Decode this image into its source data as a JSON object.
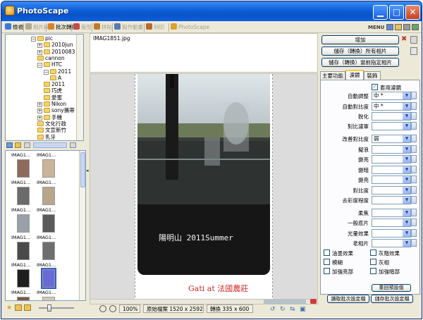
{
  "window": {
    "title": "PhotoScape"
  },
  "toolbar": {
    "items": [
      {
        "label": "檢視",
        "dim": false,
        "color": "#3a7bd5"
      },
      {
        "label": "相片編輯",
        "dim": true,
        "color": "#b0a890"
      },
      {
        "label": "批次轉換",
        "dim": false,
        "color": "#d9822b"
      },
      {
        "label": "版型",
        "dim": true,
        "color": "#c24a4a"
      },
      {
        "label": "拼貼",
        "dim": true,
        "color": "#c27a2a"
      },
      {
        "label": "製作動畫",
        "dim": true,
        "color": "#5a7ab0"
      },
      {
        "label": "列印",
        "dim": true,
        "color": "#b86a30"
      },
      {
        "label": "PhotoScape",
        "dim": true,
        "color": "#e0a030"
      }
    ],
    "menu_label": "MENU"
  },
  "tree": [
    {
      "indent": 0,
      "pm": "−",
      "label": "pic"
    },
    {
      "indent": 1,
      "pm": "+",
      "label": "2010jun"
    },
    {
      "indent": 1,
      "pm": "+",
      "label": "2010083"
    },
    {
      "indent": 1,
      "pm": "",
      "label": "cannon"
    },
    {
      "indent": 1,
      "pm": "−",
      "label": "HTC"
    },
    {
      "indent": 2,
      "pm": "−",
      "label": "2011"
    },
    {
      "indent": 3,
      "pm": "",
      "label": "A"
    },
    {
      "indent": 2,
      "pm": "",
      "label": "2011"
    },
    {
      "indent": 2,
      "pm": "",
      "label": "巧虎"
    },
    {
      "indent": 2,
      "pm": "",
      "label": "愛蜜"
    },
    {
      "indent": 1,
      "pm": "+",
      "label": "Nikon"
    },
    {
      "indent": 1,
      "pm": "+",
      "label": "sony攜帶"
    },
    {
      "indent": 1,
      "pm": "+",
      "label": "手機"
    },
    {
      "indent": 1,
      "pm": "",
      "label": "文化行政"
    },
    {
      "indent": 1,
      "pm": "",
      "label": "文宣新竹"
    },
    {
      "indent": 1,
      "pm": "",
      "label": "乳牙"
    }
  ],
  "thumbnails": [
    {
      "name": "IMAG1...",
      "selected": false
    },
    {
      "name": "IMAG1...",
      "selected": false
    },
    {
      "name": "IMAG1...",
      "selected": false
    },
    {
      "name": "IMAG1...",
      "selected": false
    },
    {
      "name": "IMAG1...",
      "selected": false
    },
    {
      "name": "IMAG1...",
      "selected": false
    },
    {
      "name": "IMAG1...",
      "selected": false
    },
    {
      "name": "IMAG1...",
      "selected": false
    },
    {
      "name": "IMAG1...",
      "selected": false
    },
    {
      "name": "IMAG1...",
      "selected": true
    },
    {
      "name": "IMAG1...",
      "selected": false
    },
    {
      "name": "IMAG1...",
      "selected": false
    }
  ],
  "image": {
    "filename": "IMAG1851.jpg",
    "caption": "陽明山 2011Summer",
    "footer": "Gati at 法國農莊"
  },
  "status": {
    "zoom": "100%",
    "original": "原始檔案 1520 x 2592",
    "converted": "轉換 335 x 600"
  },
  "right": {
    "add_button": "增加",
    "save_all_button": "儲存（轉換）所有相片",
    "save_selected_button": "儲存（轉換）當前指定相片",
    "tabs": [
      "主要功能",
      "濾鏡",
      "裝飾"
    ],
    "active_tab": 1,
    "apply_filter_label": "套用濾鏡",
    "props": [
      {
        "label": "自動調整",
        "value": "中 *"
      },
      {
        "label": "自動對比度",
        "value": "中 *"
      },
      {
        "label": "銳化",
        "value": ""
      },
      {
        "label": "對比濾軍",
        "value": ""
      },
      {
        "label": "改善對比度",
        "value": "弱"
      },
      {
        "label": "擬浪",
        "value": ""
      },
      {
        "label": "變亮",
        "value": ""
      },
      {
        "label": "變暗",
        "value": ""
      },
      {
        "label": "變亮",
        "value": ""
      },
      {
        "label": "對比度",
        "value": ""
      },
      {
        "label": "去彩度程度",
        "value": ""
      },
      {
        "label": "柔焦",
        "value": ""
      },
      {
        "label": "一般底片",
        "value": ""
      },
      {
        "label": "光暈效果",
        "value": ""
      },
      {
        "label": "老相片",
        "value": ""
      }
    ],
    "checks": [
      {
        "label": "油墨效果",
        "checked": false
      },
      {
        "label": "灰階效果",
        "checked": false
      },
      {
        "label": "模糊",
        "checked": false
      },
      {
        "label": "灰相",
        "checked": false
      },
      {
        "label": "加強亮部",
        "checked": false
      },
      {
        "label": "加強暗部",
        "checked": false
      }
    ],
    "reset_button": "重回預設值",
    "load_settings_button": "讀取批次設定檔",
    "save_settings_button": "儲存批次設定檔"
  },
  "colors": {
    "title_bar": "#0c5fd8",
    "face": "#ece9d8",
    "footer_text": "#d22b2b"
  }
}
